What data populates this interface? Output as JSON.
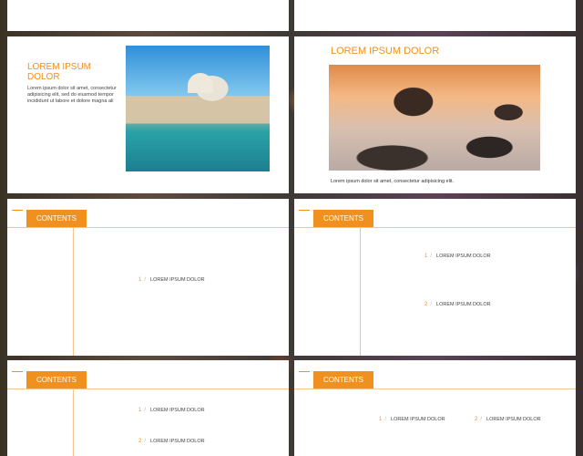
{
  "slide3": {
    "title": "LOREM IPSUM DOLOR",
    "body": "Lorem ipsum dolor sit amet, consectetur adipisicing elit, sed do eiusmod tempor incididunt ut labore et dolore magna ali"
  },
  "slide4": {
    "title": "LOREM IPSUM DOLOR",
    "caption": "Lorem ipsum dolor sit amet, consectetur adipisicing elit."
  },
  "contents_label": "CONTENTS",
  "slide5": {
    "items": [
      {
        "num": "1",
        "label": "LOREM IPSUM DOLOR"
      }
    ]
  },
  "slide6": {
    "items": [
      {
        "num": "1",
        "label": "LOREM IPSUM DOLOR"
      },
      {
        "num": "2",
        "label": "LOREM IPSUM DOLOR"
      }
    ]
  },
  "slide7": {
    "items": [
      {
        "num": "1",
        "label": "LOREM IPSUM DOLOR"
      },
      {
        "num": "2",
        "label": "LOREM IPSUM DOLOR"
      }
    ]
  },
  "slide8": {
    "items": [
      {
        "num": "1",
        "label": "LOREM IPSUM DOLOR"
      },
      {
        "num": "2",
        "label": "LOREM IPSUM DOLOR"
      }
    ]
  },
  "colors": {
    "accent": "#f0901e",
    "line": "#f6c48a"
  },
  "icons": {
    "venice": "venice-photo",
    "rocks": "sea-rocks-photo"
  }
}
